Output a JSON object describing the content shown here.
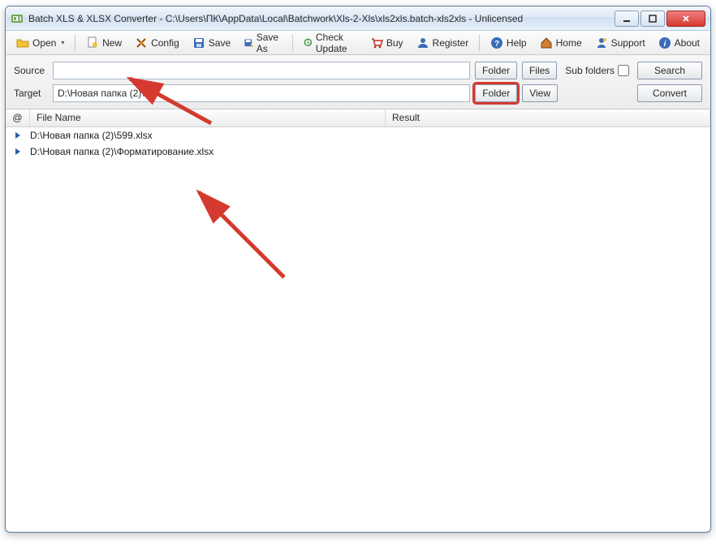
{
  "title": "Batch XLS & XLSX Converter - C:\\Users\\ПК\\AppData\\Local\\Batchwork\\Xls-2-Xls\\xls2xls.batch-xls2xls - Unlicensed",
  "toolbar": {
    "open": "Open",
    "new": "New",
    "config": "Config",
    "save": "Save",
    "saveas": "Save As",
    "check_update": "Check Update",
    "buy": "Buy",
    "register": "Register",
    "help": "Help",
    "home": "Home",
    "support": "Support",
    "about": "About"
  },
  "paths": {
    "source_label": "Source",
    "source_value": "",
    "target_label": "Target",
    "target_value": "D:\\Новая папка (2)\\",
    "folder_btn": "Folder",
    "files_btn": "Files",
    "view_btn": "View",
    "sub_folders": "Sub folders",
    "search_btn": "Search",
    "convert_btn": "Convert"
  },
  "list": {
    "col_cmd": "@",
    "col_name": "File Name",
    "col_result": "Result",
    "rows": [
      {
        "name": "D:\\Новая папка (2)\\599.xlsx",
        "result": ""
      },
      {
        "name": "D:\\Новая папка (2)\\Форматирование.xlsx",
        "result": ""
      }
    ]
  }
}
